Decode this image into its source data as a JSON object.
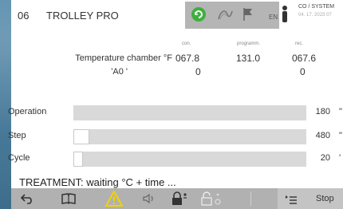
{
  "header": {
    "program_number": "06",
    "program_name": "TROLLEY PRO",
    "language": "EN",
    "system_label": "CO / SYSTEM",
    "date_text": "04. 17. 2023  07"
  },
  "table": {
    "columns": [
      "con.",
      "programm.",
      "rec."
    ],
    "rows": [
      {
        "label": "Temperature chamber °F",
        "con": "067.8",
        "programm": "131.0",
        "rec": "067.6"
      },
      {
        "label": "'A0 '",
        "con": "0",
        "programm": "",
        "rec": "0"
      }
    ]
  },
  "bars": [
    {
      "label": "Operation",
      "value": "180",
      "unit": "\"",
      "fill_fraction": 0.0
    },
    {
      "label": "Step",
      "value": "480",
      "unit": "\"",
      "fill_fraction": 0.07
    },
    {
      "label": "Cycle",
      "value": "20",
      "unit": "'",
      "fill_fraction": 0.04
    }
  ],
  "status_message": "TREATMENT: waiting °C + time ...",
  "toolbar": {
    "stop_label": "Stop"
  },
  "icons": [
    "green-status-icon",
    "loop-icon",
    "flag-icon",
    "person-icon",
    "back-icon",
    "book-icon",
    "warning-icon",
    "volume-icon",
    "lock-icon",
    "unlock-icon",
    "list-icon"
  ],
  "colors": {
    "status_green": "#3fae3f",
    "warning_yellow": "#f2d200",
    "toolbar_gray": "#b1b1b1",
    "track_gray": "#d9d9d9"
  }
}
